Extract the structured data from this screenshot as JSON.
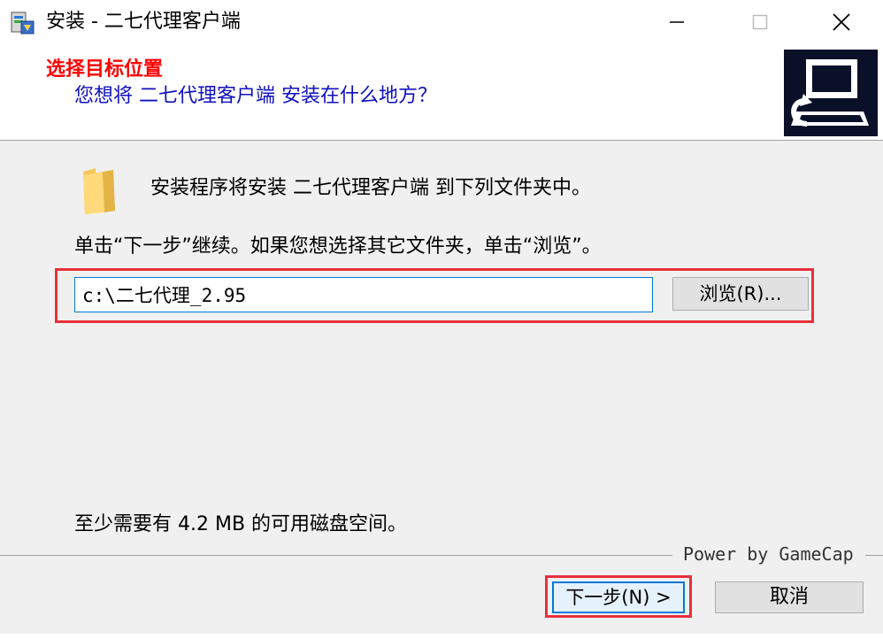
{
  "window": {
    "title": "安装 - 二七代理客户端",
    "controls": {
      "minimize_icon": "minimize-icon",
      "maximize_icon": "maximize-icon",
      "close_icon": "close-icon"
    }
  },
  "header": {
    "title": "选择目标位置",
    "subtitle": "您想将 二七代理客户端 安装在什么地方？",
    "title_color": "#ff0000",
    "subtitle_color": "#1010c0"
  },
  "body": {
    "intro": "安装程序将安装 二七代理客户端 到下列文件夹中。",
    "instruction": "单击“下一步”继续。如果您想选择其它文件夹，单击“浏览”。",
    "path_value": "c:\\二七代理_2.95",
    "browse_label": "浏览(R)...",
    "disk_space": "至少需要有 4.2 MB 的可用磁盘空间。"
  },
  "footer": {
    "powered_by": "Power by GameCap",
    "next_label": "下一步(N) >",
    "cancel_label": "取消"
  },
  "colors": {
    "highlight": "#e8303a",
    "focus_blue": "#0078d7"
  }
}
